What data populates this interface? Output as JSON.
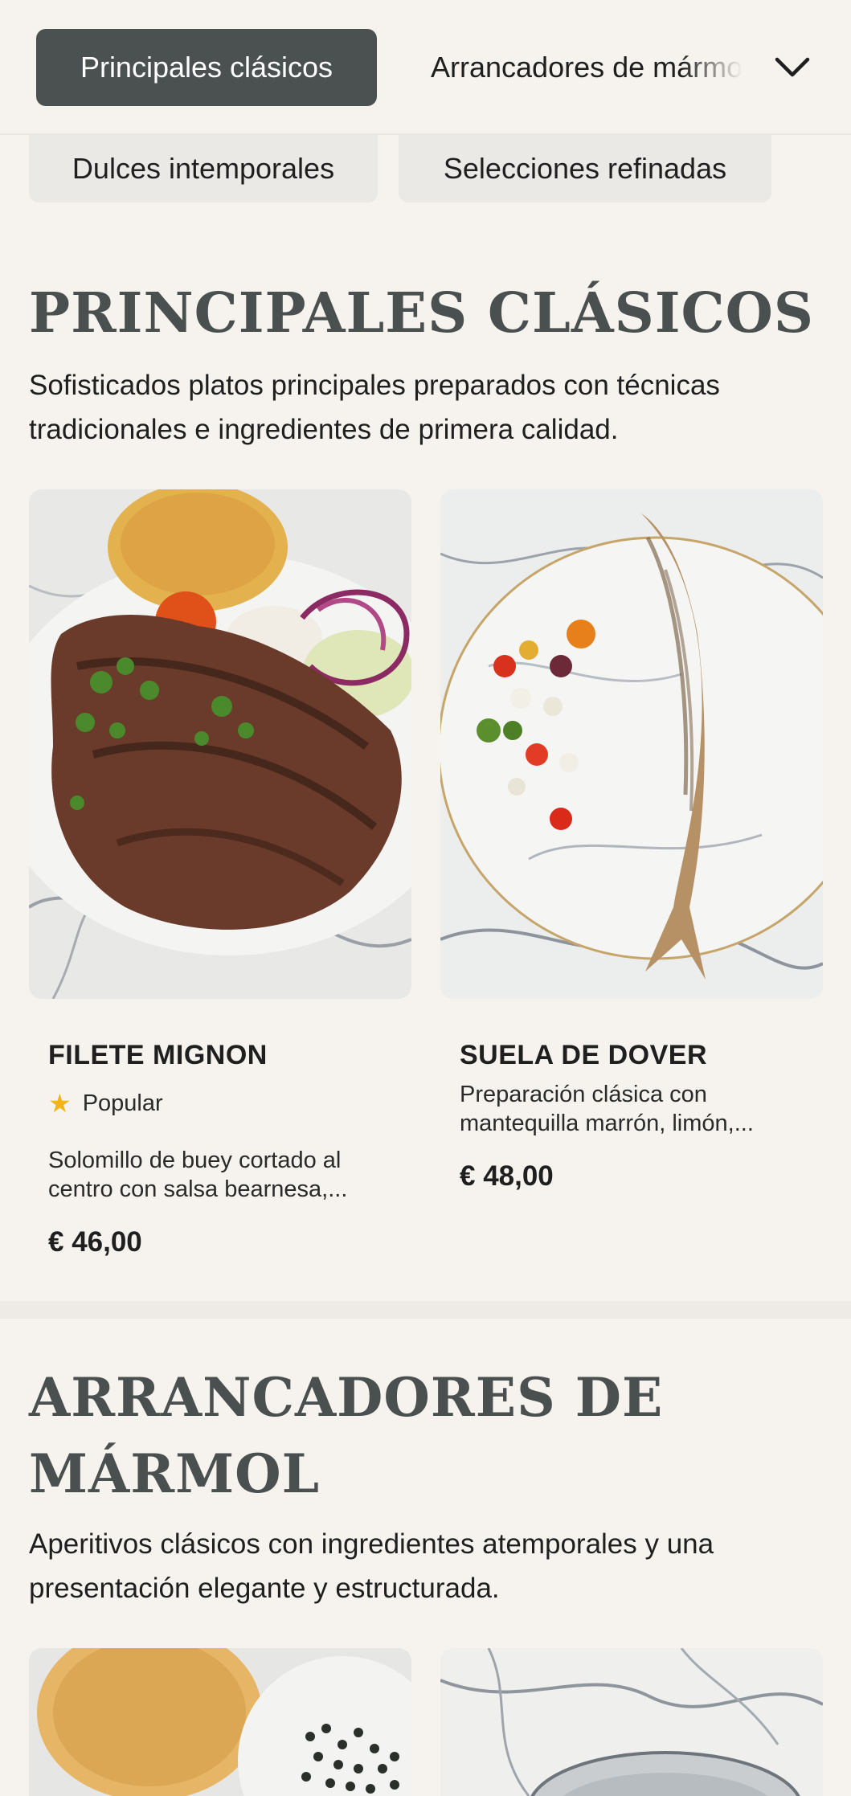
{
  "nav": {
    "active_tab": "Principales clásicos",
    "next_tab": "Arrancadores de mármol",
    "row2_tabs": [
      "Dulces intemporales",
      "Selecciones refinadas"
    ]
  },
  "sections": [
    {
      "title": "PRINCIPALES CLÁSICOS",
      "description": "Sofisticados platos principales preparados con técnicas tradicionales e ingredientes de primera calidad.",
      "items": [
        {
          "name": "FILETE MIGNON",
          "badge": "Popular",
          "badge_icon": "star-icon",
          "description": "Solomillo de buey cortado al centro con salsa bearnesa,...",
          "price": "€ 46,00",
          "image": "grilled-steak-photo"
        },
        {
          "name": "SUELA DE DOVER",
          "description": "Preparación clásica con mantequilla marrón, limón,...",
          "price": "€ 48,00",
          "image": "grilled-fish-photo"
        }
      ]
    },
    {
      "title_line1": "ARRANCADORES DE",
      "title_line2": "MÁRMOL",
      "description": "Aperitivos clásicos con ingredientes atemporales y una presentación elegante y estructurada.",
      "items": [
        {
          "image": "flatbread-caviar-photo"
        },
        {
          "image": "marble-bowl-photo"
        }
      ]
    }
  ],
  "colors": {
    "background": "#f6f3ee",
    "active_pill": "#4a5150",
    "soft_pill": "#ebe9e5",
    "heading": "#4a4f4f",
    "star": "#f2b418"
  }
}
